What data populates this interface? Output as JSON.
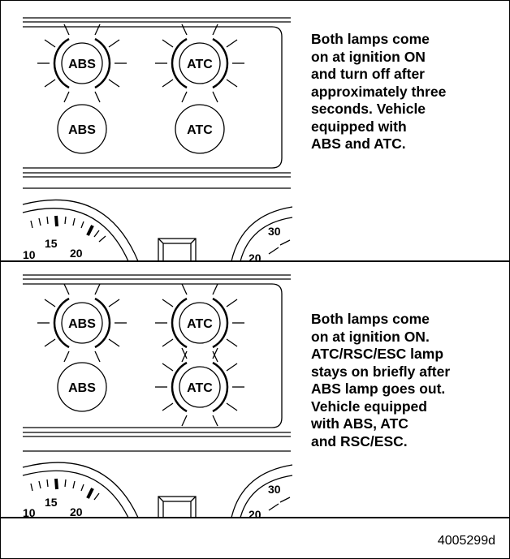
{
  "panels": [
    {
      "caption": "Both lamps come\non at ignition ON\nand turn off after\napproximately three\nseconds. Vehicle\nequipped with\nABS and ATC.",
      "lamps": [
        {
          "label": "ABS",
          "state": "illuminated"
        },
        {
          "label": "ATC",
          "state": "illuminated"
        },
        {
          "label": "ABS",
          "state": "off"
        },
        {
          "label": "ATC",
          "state": "off"
        }
      ],
      "gauge_left_labels": [
        "10",
        "15",
        "20"
      ],
      "gauge_right_labels": [
        "30",
        "20"
      ]
    },
    {
      "caption": "Both lamps come\non at ignition ON.\nATC/RSC/ESC lamp\nstays on briefly after\nABS lamp goes out.\nVehicle equipped\nwith ABS, ATC\nand RSC/ESC.",
      "lamps": [
        {
          "label": "ABS",
          "state": "illuminated"
        },
        {
          "label": "ATC",
          "state": "illuminated"
        },
        {
          "label": "ABS",
          "state": "off"
        },
        {
          "label": "ATC",
          "state": "illuminated"
        }
      ],
      "gauge_left_labels": [
        "10",
        "15",
        "20"
      ],
      "gauge_right_labels": [
        "30",
        "20"
      ]
    }
  ],
  "figure_id": "4005299d"
}
